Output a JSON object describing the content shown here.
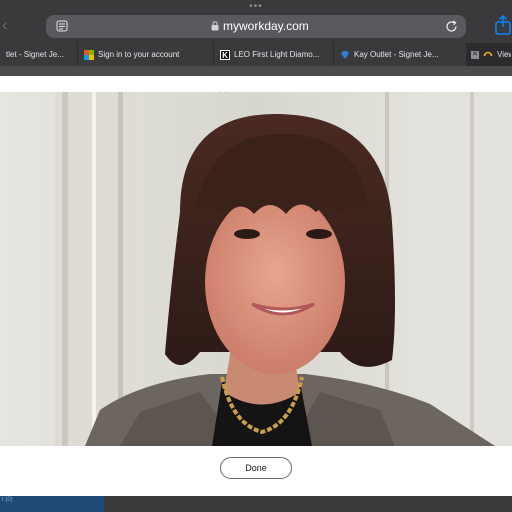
{
  "browser": {
    "more_dots": "•••",
    "url": "myworkday.com",
    "tabs": [
      {
        "label": "tlet - Signet Je...",
        "icon": "none"
      },
      {
        "label": "Sign in to your account",
        "icon": "microsoft-icon"
      },
      {
        "label": "LEO First Light Diamo...",
        "icon": "k-icon"
      },
      {
        "label": "Kay Outlet - Signet Je...",
        "icon": "diamond-icon"
      },
      {
        "label": "View",
        "icon": "loading-icon"
      }
    ]
  },
  "modal": {
    "done_label": "Done"
  },
  "footer": {
    "faint_text": "t (0)"
  },
  "colors": {
    "chrome": "#3a3a3c",
    "urlbar": "#5a5a5e",
    "accent_blue": "#1f4a78",
    "share_blue": "#0a84ff"
  }
}
